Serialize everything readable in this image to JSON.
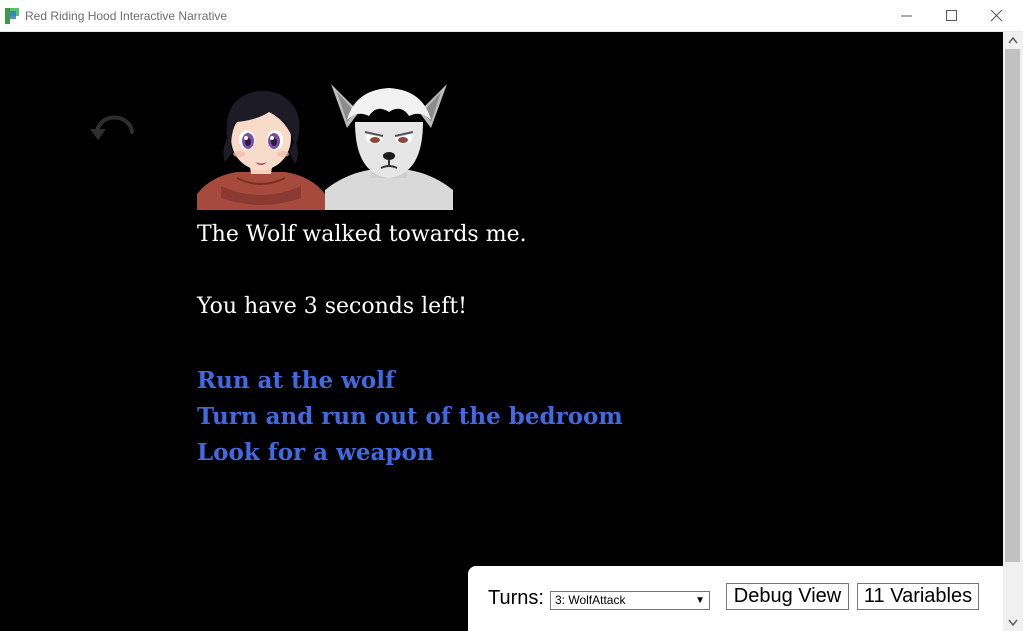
{
  "window": {
    "title": "Red Riding Hood Interactive Narrative"
  },
  "story": {
    "lines": [
      "The Wolf walked towards me.",
      "You have 3 seconds left!"
    ],
    "choices": [
      "Run at the wolf",
      "Turn and run out of the bedroom",
      "Look for a weapon"
    ]
  },
  "debug": {
    "turns_label": "Turns:",
    "turns_selected": "3: WolfAttack",
    "debug_view_label": "Debug View",
    "variables_label": "11 Variables"
  },
  "colors": {
    "background": "#000000",
    "text": "#ffffff",
    "link": "#4169e1"
  },
  "icons": [
    "app-icon",
    "undo-icon",
    "minimize-icon",
    "maximize-icon",
    "close-icon",
    "chevron-down-icon"
  ]
}
